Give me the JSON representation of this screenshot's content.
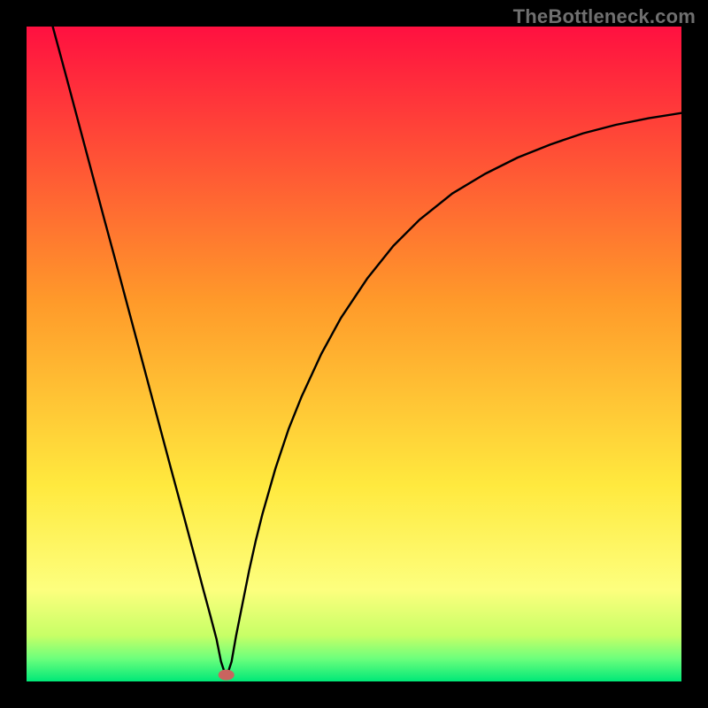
{
  "watermark": "TheBottleneck.com",
  "chart_data": {
    "type": "line",
    "title": "",
    "xlabel": "",
    "ylabel": "",
    "xlim": [
      0,
      100
    ],
    "ylim": [
      0,
      100
    ],
    "grid": false,
    "legend": false,
    "background_gradient": {
      "stops": [
        {
          "offset": 0.0,
          "color": "#ff1040"
        },
        {
          "offset": 0.42,
          "color": "#ff9a2a"
        },
        {
          "offset": 0.7,
          "color": "#ffe93e"
        },
        {
          "offset": 0.86,
          "color": "#fdff7e"
        },
        {
          "offset": 0.93,
          "color": "#c7ff66"
        },
        {
          "offset": 0.965,
          "color": "#6dff7c"
        },
        {
          "offset": 1.0,
          "color": "#00e878"
        }
      ]
    },
    "marker": {
      "x": 30.5,
      "y": 1.0,
      "color": "#c9645f"
    },
    "series": [
      {
        "name": "bottleneck-curve",
        "color": "#000000",
        "x": [
          4.0,
          6,
          8,
          10,
          12,
          14,
          16,
          18,
          20,
          22,
          24,
          26,
          27,
          28,
          29,
          29.7,
          30.5,
          31.3,
          32,
          33,
          34,
          35,
          36,
          38,
          40,
          42,
          45,
          48,
          52,
          56,
          60,
          65,
          70,
          75,
          80,
          85,
          90,
          95,
          100
        ],
        "y": [
          100,
          92.6,
          85.1,
          77.6,
          70.1,
          62.7,
          55.2,
          47.7,
          40.2,
          32.7,
          25.3,
          17.8,
          14.0,
          10.3,
          6.5,
          3.0,
          0.6,
          3.0,
          7.0,
          12.0,
          17.0,
          21.5,
          25.5,
          32.5,
          38.5,
          43.5,
          50.0,
          55.5,
          61.5,
          66.5,
          70.5,
          74.5,
          77.5,
          80.0,
          82.0,
          83.7,
          85.0,
          86.0,
          86.8
        ]
      }
    ]
  }
}
